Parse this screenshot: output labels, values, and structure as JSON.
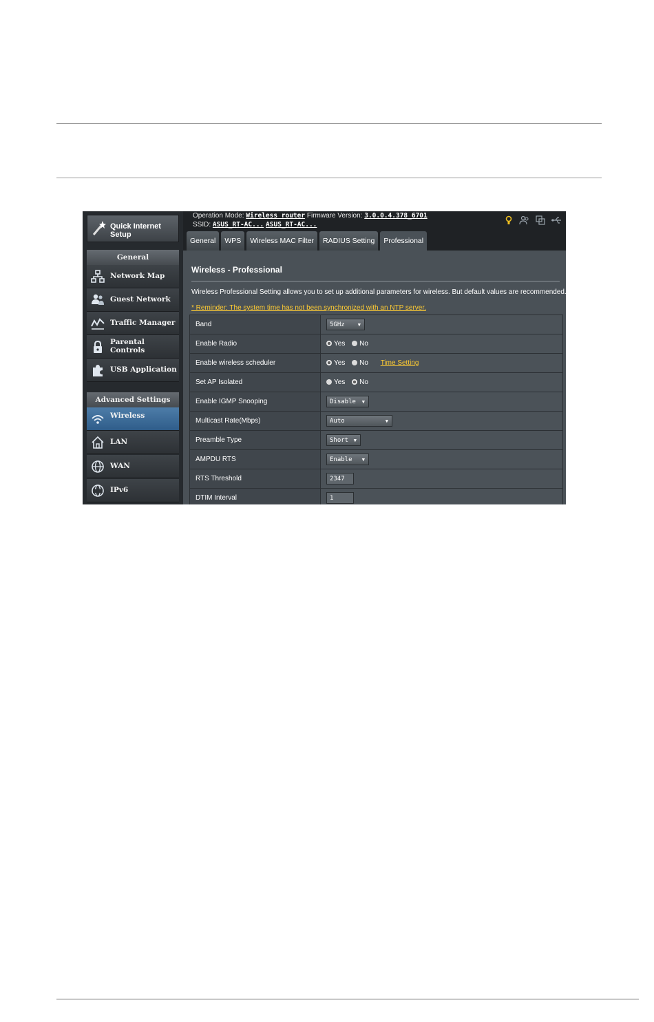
{
  "router": {
    "op_label": "Operation Mode:",
    "op_value": "Wireless router",
    "fw_label": "Firmware Version:",
    "fw_value": "3.0.0.4.378_6701",
    "ssid_label": "SSID:",
    "ssid_1": "ASUS_RT-AC...",
    "ssid_2": "ASUS_RT-AC..."
  },
  "sidebar": {
    "qis": "Quick Internet Setup",
    "general_header": "General",
    "general_items": [
      {
        "label": "Network Map",
        "icon": "network-map-icon"
      },
      {
        "label": "Guest Network",
        "icon": "guest-network-icon"
      },
      {
        "label": "Traffic Manager",
        "icon": "traffic-manager-icon"
      },
      {
        "label": "Parental Controls",
        "icon": "lock-icon"
      },
      {
        "label": "USB Application",
        "icon": "puzzle-icon"
      }
    ],
    "advanced_header": "Advanced Settings",
    "advanced_items": [
      {
        "label": "Wireless",
        "icon": "wifi-icon"
      },
      {
        "label": "LAN",
        "icon": "home-icon"
      },
      {
        "label": "WAN",
        "icon": "globe-icon"
      },
      {
        "label": "IPv6",
        "icon": "ipv6-globe-icon"
      }
    ]
  },
  "tabs": [
    "General",
    "WPS",
    "Wireless MAC Filter",
    "RADIUS Setting",
    "Professional"
  ],
  "active_tab": "Professional",
  "page": {
    "title": "Wireless - Professional",
    "description": "Wireless Professional Setting allows you to set up additional parameters for wireless. But default values are recommended.",
    "reminder": "* Reminder: The system time has not been synchronized with an NTP server."
  },
  "settings": {
    "band": {
      "label": "Band",
      "value": "5GHz"
    },
    "enable_radio": {
      "label": "Enable Radio",
      "yes": "Yes",
      "no": "No",
      "selected": "Yes"
    },
    "scheduler": {
      "label": "Enable wireless scheduler",
      "yes": "Yes",
      "no": "No",
      "selected": "Yes",
      "link": "Time Setting"
    },
    "ap_isolated": {
      "label": "Set AP Isolated",
      "yes": "Yes",
      "no": "No",
      "selected": "No"
    },
    "igmp": {
      "label": "Enable IGMP Snooping",
      "value": "Disable"
    },
    "multicast": {
      "label": "Multicast Rate(Mbps)",
      "value": "Auto"
    },
    "preamble": {
      "label": "Preamble Type",
      "value": "Short"
    },
    "ampdu": {
      "label": "AMPDU RTS",
      "value": "Enable"
    },
    "rts": {
      "label": "RTS Threshold",
      "value": "2347"
    },
    "dtim": {
      "label": "DTIM Interval",
      "value": "1"
    }
  },
  "colors": {
    "accent_link": "#ffcc33",
    "active_nav": "#3b6b98",
    "panel": "#4a5157"
  }
}
